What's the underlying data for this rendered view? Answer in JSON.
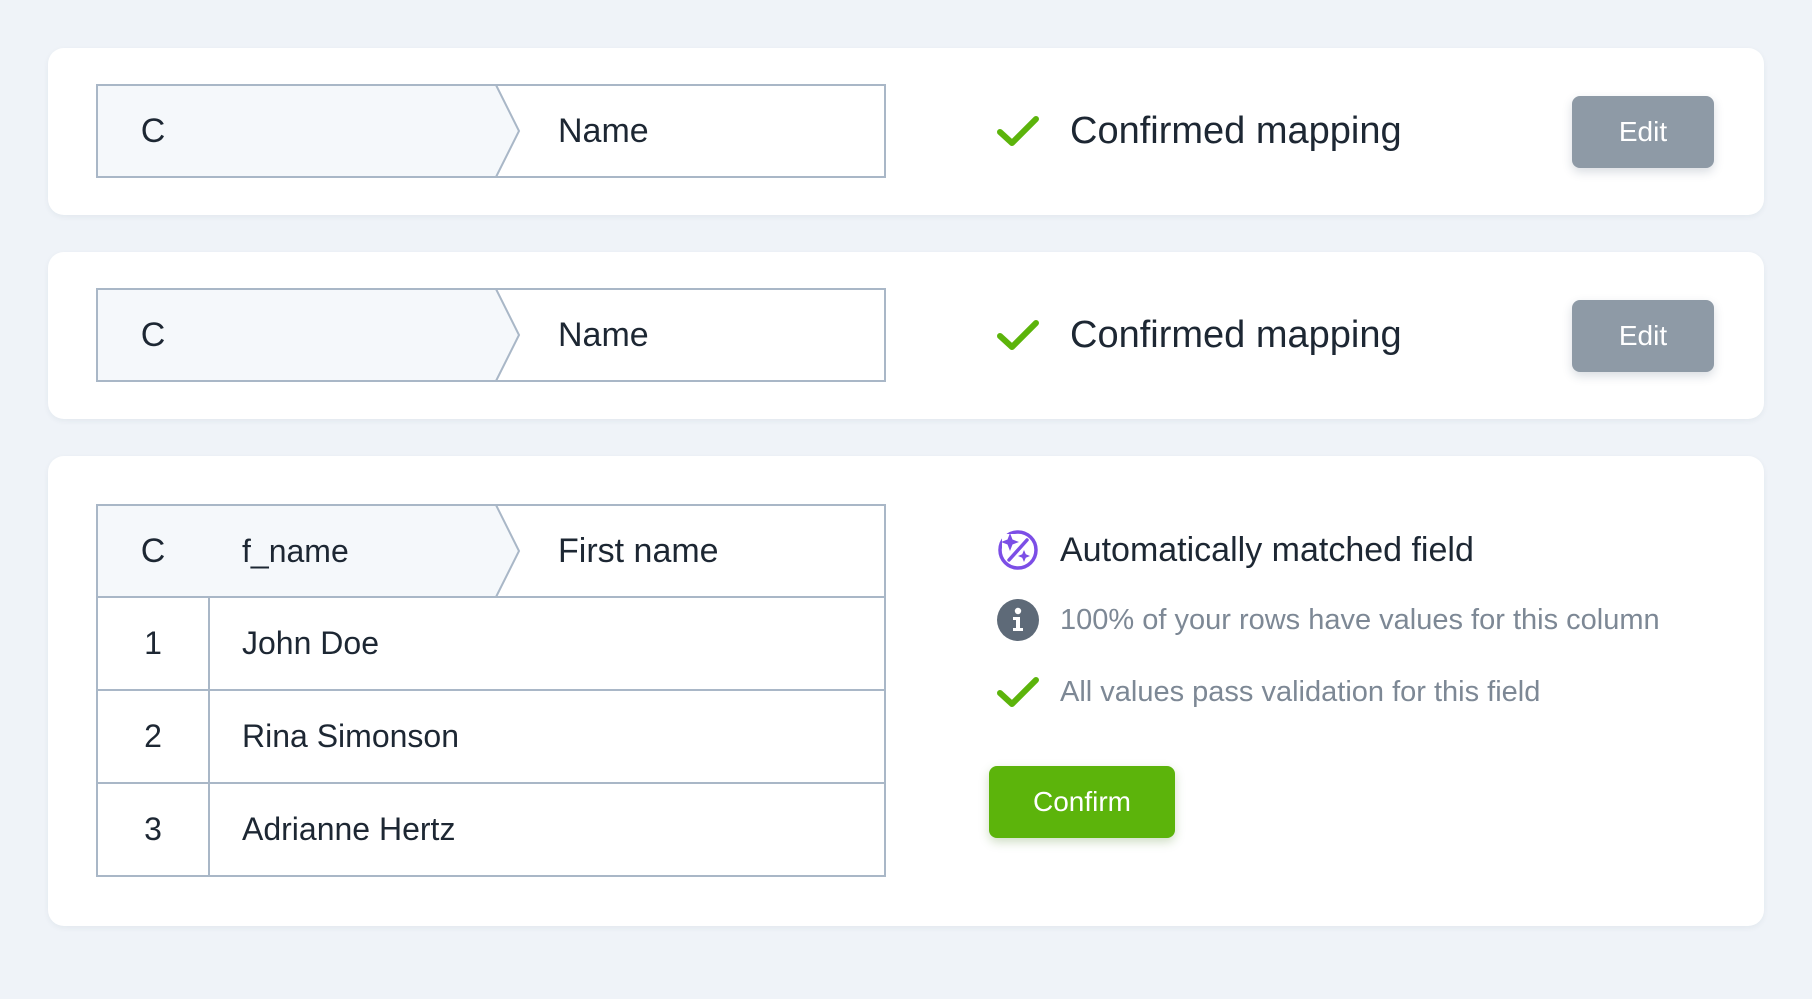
{
  "mappings": [
    {
      "column_letter": "C",
      "source_header": "",
      "target_field": "Name",
      "status": "Confirmed mapping",
      "action_label": "Edit"
    },
    {
      "column_letter": "C",
      "source_header": "",
      "target_field": "Name",
      "status": "Confirmed mapping",
      "action_label": "Edit"
    }
  ],
  "active_mapping": {
    "column_letter": "C",
    "source_header": "f_name",
    "target_field": "First name",
    "rows": [
      {
        "index": "1",
        "value": "John Doe"
      },
      {
        "index": "2",
        "value": "Rina Simonson"
      },
      {
        "index": "3",
        "value": "Adrianne Hertz"
      }
    ],
    "match_title": "Automatically matched field",
    "coverage_note": "100% of your rows have values for this column",
    "validation_note": "All values pass validation for this field",
    "confirm_label": "Confirm"
  },
  "icons": {
    "check": "check-icon",
    "auto_match": "sparkle-match-icon",
    "info": "info-icon"
  },
  "colors": {
    "background": "#eff3f8",
    "card": "#ffffff",
    "border": "#a9b7c7",
    "header_fill": "#f5f8fb",
    "check_green": "#5cb40b",
    "confirm_button": "#5cb40b",
    "edit_button": "#8e9aa6",
    "auto_match_purple": "#7c4ee6",
    "info_gray": "#5e6a78",
    "muted_text": "#7d8895"
  }
}
